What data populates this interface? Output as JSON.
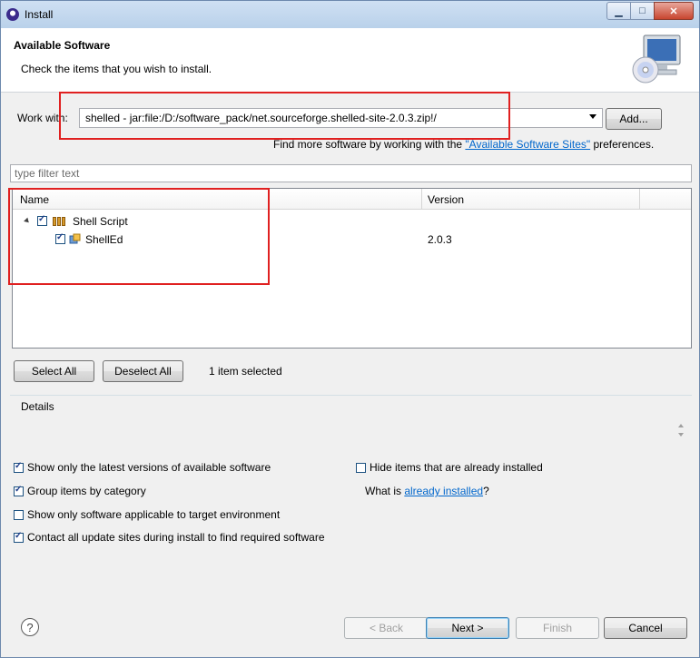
{
  "window": {
    "title": "Install"
  },
  "banner": {
    "title": "Available Software",
    "subtitle": "Check the items that you wish to install."
  },
  "work_with": {
    "label": "Work with:",
    "value": "shelled - jar:file:/D:/software_pack/net.sourceforge.shelled-site-2.0.3.zip!/",
    "add_label": "Add...",
    "hint_prefix": "Find more software by working with the ",
    "hint_link": "\"Available Software Sites\"",
    "hint_suffix": " preferences."
  },
  "filter": {
    "placeholder": "type filter text"
  },
  "tree": {
    "columns": {
      "name": "Name",
      "version": "Version"
    },
    "rows": [
      {
        "name": "Shell Script",
        "version": "",
        "checked": true,
        "expanded": true
      },
      {
        "name": "ShellEd",
        "version": "2.0.3",
        "checked": true
      }
    ]
  },
  "selection": {
    "select_all": "Select All",
    "deselect_all": "Deselect All",
    "status": "1 item selected"
  },
  "details": {
    "label": "Details"
  },
  "options": {
    "latest_only": {
      "label": "Show only the latest versions of available software",
      "checked": true
    },
    "hide_installed": {
      "label": "Hide items that are already installed",
      "checked": false
    },
    "group_by_category": {
      "label": "Group items by category",
      "checked": true
    },
    "what_is_prefix": "What is ",
    "what_is_link": "already installed",
    "what_is_suffix": "?",
    "target_env_only": {
      "label": "Show only software applicable to target environment",
      "checked": false
    },
    "contact_all_sites": {
      "label": "Contact all update sites during install to find required software",
      "checked": true
    }
  },
  "footer": {
    "help": "?",
    "back": "< Back",
    "next": "Next >",
    "finish": "Finish",
    "cancel": "Cancel"
  }
}
